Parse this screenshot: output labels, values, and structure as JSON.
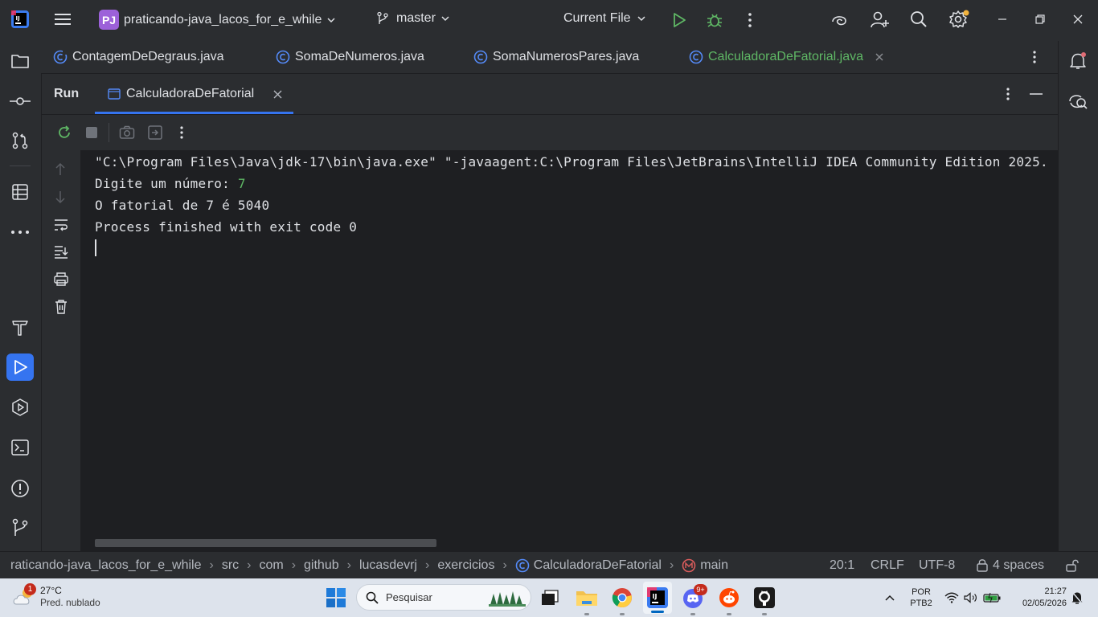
{
  "titlebar": {
    "project_badge": "PJ",
    "project_name": "praticando-java_lacos_for_e_while",
    "branch": "master",
    "run_config": "Current File"
  },
  "editor_tabs": [
    {
      "label": "ContagemDeDegraus.java"
    },
    {
      "label": "SomaDeNumeros.java"
    },
    {
      "label": "SomaNumerosPares.java"
    },
    {
      "label": "CalculadoraDeFatorial.java",
      "active": true
    }
  ],
  "run_panel": {
    "title": "Run",
    "tab_label": "CalculadoraDeFatorial"
  },
  "console": {
    "command_line": "\"C:\\Program Files\\Java\\jdk-17\\bin\\java.exe\" \"-javaagent:C:\\Program Files\\JetBrains\\IntelliJ IDEA Community Edition 2025.",
    "prompt": "Digite um número: ",
    "input_value": "7",
    "result": "O fatorial de 7 é 5040",
    "exit": "Process finished with exit code 0"
  },
  "statusbar": {
    "breadcrumbs": [
      "raticando-java_lacos_for_e_while",
      "src",
      "com",
      "github",
      "lucasdevrj",
      "exercicios",
      "CalculadoraDeFatorial",
      "main"
    ],
    "position": "20:1",
    "line_ending": "CRLF",
    "encoding": "UTF-8",
    "indent": "4 spaces"
  },
  "taskbar": {
    "weather_temp": "27°C",
    "weather_desc": "Pred. nublado",
    "weather_badge": "1",
    "search_placeholder": "Pesquisar",
    "discord_badge": "9+",
    "lang_top": "POR",
    "lang_bottom": "PTB2",
    "time": "21:27",
    "date": "02/05/2026"
  },
  "colors": {
    "accent": "#3574f0",
    "run_green": "#5fb865",
    "console_bg": "#1e1f22",
    "ide_bg": "#2b2d30",
    "taskbar_bg": "#dde3ec"
  }
}
